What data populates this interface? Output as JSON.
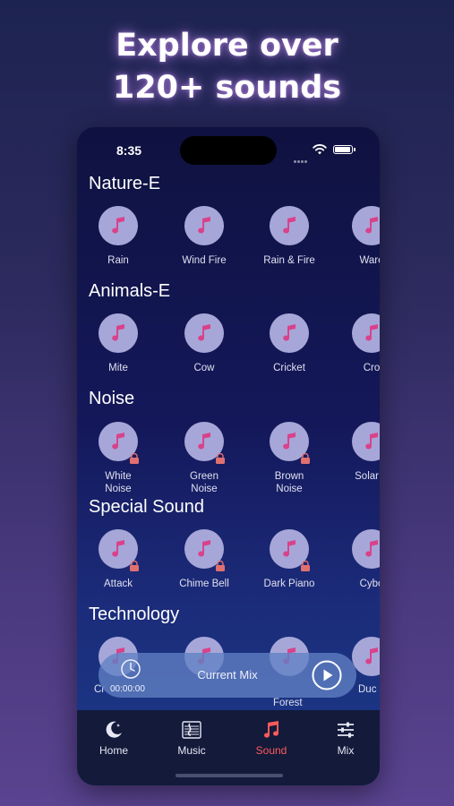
{
  "headline": {
    "line1": "Explore over",
    "line2": "120+ sounds"
  },
  "status_bar": {
    "time": "8:35"
  },
  "sections": [
    {
      "title": "Nature-E",
      "items": [
        {
          "label": "Rain",
          "locked": false
        },
        {
          "label": "Wind Fire",
          "locked": false
        },
        {
          "label": "Rain & Fire",
          "locked": false
        },
        {
          "label": "Ware",
          "locked": false
        }
      ]
    },
    {
      "title": "Animals-E",
      "items": [
        {
          "label": "Mite",
          "locked": false
        },
        {
          "label": "Cow",
          "locked": false
        },
        {
          "label": "Cricket",
          "locked": false
        },
        {
          "label": "Cro",
          "locked": false
        }
      ]
    },
    {
      "title": "Noise",
      "items": [
        {
          "label_line1": "White",
          "label_line2": "Noise",
          "locked": true
        },
        {
          "label_line1": "Green",
          "label_line2": "Noise",
          "locked": true
        },
        {
          "label_line1": "Brown",
          "label_line2": "Noise",
          "locked": true
        },
        {
          "label_line1": "Solar V",
          "label_line2": "",
          "locked": false
        }
      ]
    },
    {
      "title": "Special Sound",
      "items": [
        {
          "label": "Attack",
          "locked": true
        },
        {
          "label": "Chime Bell",
          "locked": true
        },
        {
          "label": "Dark Piano",
          "locked": true
        },
        {
          "label": "Cybo",
          "locked": false
        }
      ]
    },
    {
      "title": "Technology",
      "items": [
        {
          "label": "Cr",
          "locked": false
        },
        {
          "label": "",
          "locked": false
        },
        {
          "label": "Forest",
          "locked": false
        },
        {
          "label": "Duc",
          "locked": false
        }
      ]
    }
  ],
  "mini_player": {
    "timer": "00:00:00",
    "title": "Current Mix",
    "play_icon": "play-icon"
  },
  "tabbar": {
    "tabs": [
      {
        "label": "Home",
        "icon": "moon-icon",
        "active": false
      },
      {
        "label": "Music",
        "icon": "music-staff-icon",
        "active": false
      },
      {
        "label": "Sound",
        "icon": "music-note-icon",
        "active": true
      },
      {
        "label": "Mix",
        "icon": "sliders-icon",
        "active": false
      }
    ]
  },
  "colors": {
    "accent": "#ff5a5a",
    "icon_circle": "#a6a7d8",
    "note": "#d9428b",
    "lock": "#e07070"
  }
}
